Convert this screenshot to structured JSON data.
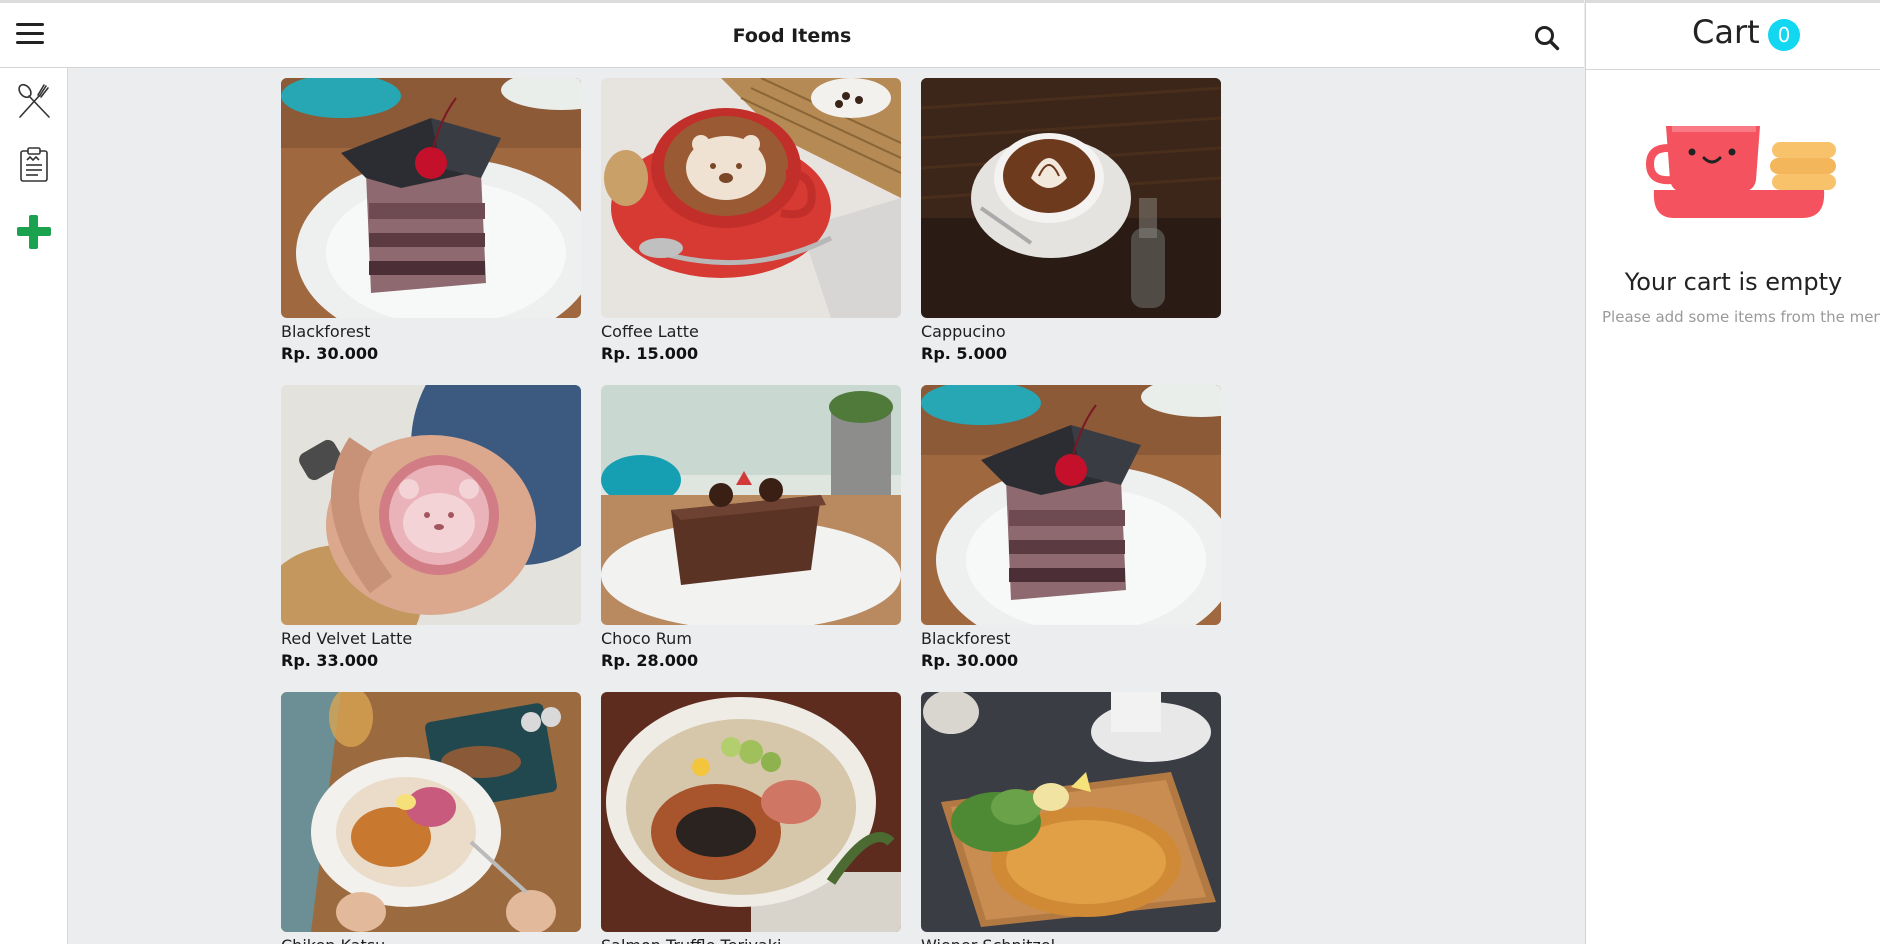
{
  "header": {
    "title": "Food Items",
    "menu_icon": "hamburger-menu-icon",
    "search_icon": "search-icon"
  },
  "sidebar": {
    "items": [
      {
        "name": "fork-spoon-icon"
      },
      {
        "name": "receipt-icon"
      },
      {
        "name": "add-plus-icon",
        "color": "#1aa24f"
      }
    ]
  },
  "menu": {
    "items": [
      {
        "name": "Blackforest",
        "price": "Rp. 30.000"
      },
      {
        "name": "Coffee Latte",
        "price": "Rp. 15.000"
      },
      {
        "name": "Cappucino",
        "price": "Rp. 5.000"
      },
      {
        "name": "Red Velvet Latte",
        "price": "Rp. 33.000"
      },
      {
        "name": "Choco Rum",
        "price": "Rp. 28.000"
      },
      {
        "name": "Blackforest",
        "price": "Rp. 30.000"
      },
      {
        "name": "Chiken Katsu",
        "price": ""
      },
      {
        "name": "Salmon Truffle Teriyaki",
        "price": ""
      },
      {
        "name": "Wiener Schnitzel",
        "price": ""
      }
    ]
  },
  "cart": {
    "title": "Cart",
    "count": "0",
    "empty_title": "Your cart is empty",
    "empty_subtitle": "Please add some items from the menu",
    "badge_color": "#12d7f0",
    "illustration_color": "#f4525e"
  }
}
